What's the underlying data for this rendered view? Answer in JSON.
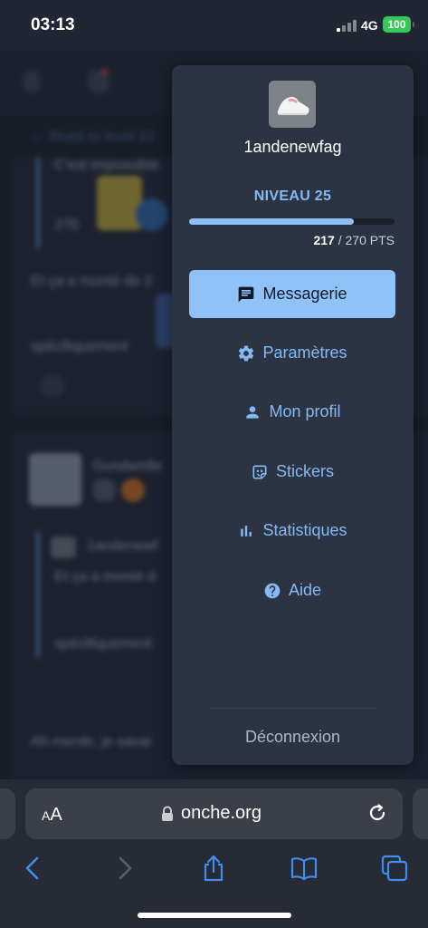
{
  "status_bar": {
    "time": "03:13",
    "network": "4G",
    "battery": "100"
  },
  "background_page": {
    "breadcrumb": "← Road to level 10",
    "post1_fragment": "C'est impossible",
    "post1_counter": "270",
    "post1_line1": "Et ça a monté de 2",
    "post1_line2": "spécifiquement",
    "post2_author": "Gundamlle",
    "quote_author": "1andenewf",
    "quote_line1": "Et ça a monté d",
    "quote_line2": "spécifiquement",
    "post2_line": "Ah merde, je savai"
  },
  "menu": {
    "username": "1andenewfag",
    "level_label": "NIVEAU 25",
    "progress": {
      "current": "217",
      "total_label": "/ 270 PTS",
      "fraction": 0.8037
    },
    "items": [
      {
        "label": "Messagerie",
        "icon": "chat-icon",
        "active": true
      },
      {
        "label": "Paramètres",
        "icon": "gear-icon",
        "active": false
      },
      {
        "label": "Mon profil",
        "icon": "person-icon",
        "active": false
      },
      {
        "label": "Stickers",
        "icon": "sticker-icon",
        "active": false
      },
      {
        "label": "Statistiques",
        "icon": "bar-chart-icon",
        "active": false
      },
      {
        "label": "Aide",
        "icon": "help-icon",
        "active": false
      }
    ],
    "logout_label": "Déconnexion"
  },
  "browser": {
    "text_size_label_small": "A",
    "text_size_label_large": "A",
    "url": "onche.org",
    "accent_color": "#3f8ef0"
  }
}
